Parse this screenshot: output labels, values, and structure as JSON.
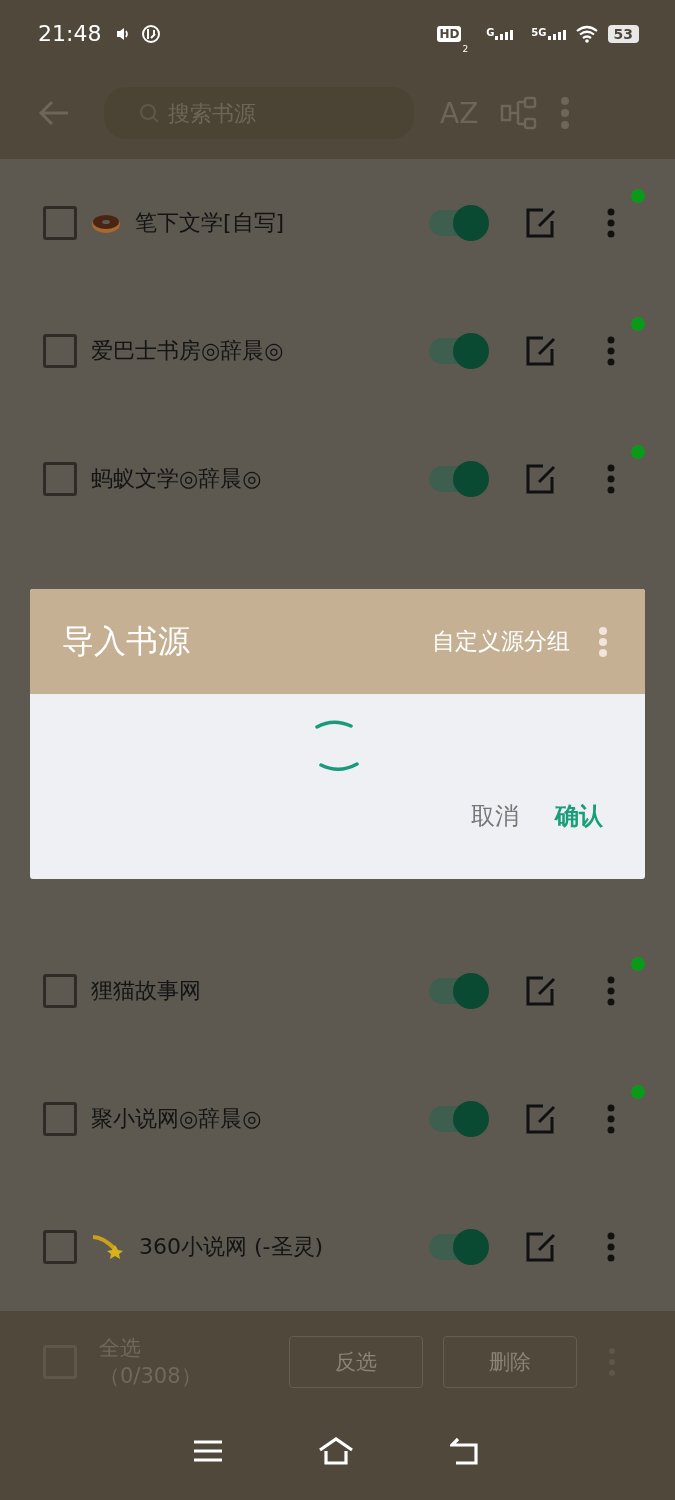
{
  "status_bar": {
    "time": "21:48",
    "hd": "HD",
    "hd_index": "2",
    "networks": [
      {
        "label": "G"
      },
      {
        "label": "5G"
      }
    ],
    "battery": "53"
  },
  "toolbar": {
    "search": {
      "placeholder": "搜索书源"
    },
    "sort_label": "AZ"
  },
  "sources": [
    {
      "kind": "donut",
      "name": "笔下文学[自写]",
      "checked": false,
      "enabled": true,
      "color": "#0a9a1a"
    },
    {
      "kind": "plain",
      "name": "爱巴士书房◎辞晨◎",
      "checked": false,
      "enabled": true,
      "color": "#0a9a1a"
    },
    {
      "kind": "plain",
      "name": "蚂蚁文学◎辞晨◎",
      "checked": false,
      "enabled": true,
      "color": "#0a9a1a"
    },
    {
      "kind": "plain",
      "name": "狸猫故事网",
      "checked": false,
      "enabled": true,
      "color": "#0a9a1a"
    },
    {
      "kind": "plain",
      "name": "聚小说网◎辞晨◎",
      "checked": false,
      "enabled": true,
      "color": "#0a9a1a"
    },
    {
      "kind": "dizzy",
      "name": "360小说网 (-圣灵)",
      "checked": false,
      "enabled": true
    }
  ],
  "bottom_bar": {
    "select_all": {
      "label": "全选",
      "count": "（0/308）",
      "checked": false
    },
    "buttons": [
      "反选",
      "删除"
    ]
  },
  "dialog": {
    "title": "导入书源",
    "group_action": "自定义源分组",
    "loading": true,
    "buttons": [
      {
        "label": "取消",
        "kind": "neutral"
      },
      {
        "label": "确认",
        "kind": "primary"
      }
    ]
  }
}
